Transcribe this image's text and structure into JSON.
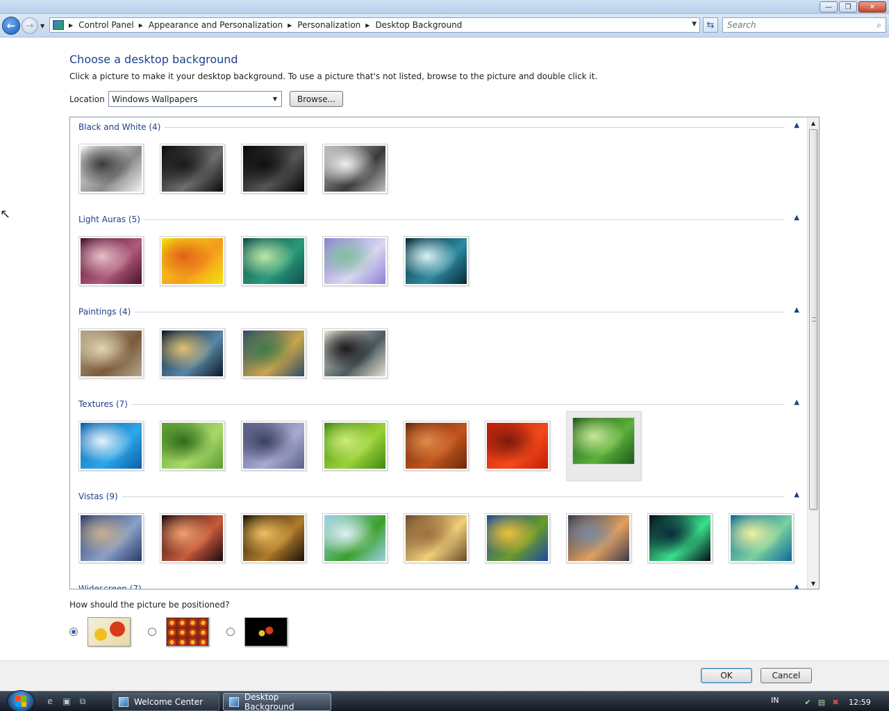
{
  "window": {
    "controls": [
      "minimize",
      "maximize",
      "close"
    ]
  },
  "nav": {
    "breadcrumbs": [
      "Control Panel",
      "Appearance and Personalization",
      "Personalization",
      "Desktop Background"
    ],
    "search_placeholder": "Search"
  },
  "main": {
    "heading": "Choose a desktop background",
    "description": "Click a picture to make it your desktop background. To use a picture that's not listed, browse to the picture and double click it.",
    "location_label": "Location",
    "location_value": "Windows Wallpapers",
    "browse_label": "Browse..."
  },
  "gallery": {
    "groups": [
      {
        "title": "Black and White (4)",
        "thumbs": [
          {
            "name": "bw-1",
            "colors": [
              "#f2f2f2",
              "#8a8a8a",
              "#3b3b3b"
            ]
          },
          {
            "name": "bw-2",
            "colors": [
              "#0a0a0a",
              "#6e6e6e",
              "#1a1a1a"
            ]
          },
          {
            "name": "bw-3",
            "colors": [
              "#050505",
              "#565656",
              "#101010"
            ]
          },
          {
            "name": "bw-4",
            "colors": [
              "#bfbfbf",
              "#3a3a3a",
              "#efefef"
            ]
          }
        ]
      },
      {
        "title": "Light Auras (5)",
        "thumbs": [
          {
            "name": "aura-1",
            "colors": [
              "#4d1130",
              "#b05a7a",
              "#e7c0c8"
            ]
          },
          {
            "name": "aura-2",
            "colors": [
              "#f1e20f",
              "#f59a1d",
              "#e35f1a"
            ]
          },
          {
            "name": "aura-3",
            "colors": [
              "#0c4f4e",
              "#2a9a7a",
              "#bfe7a6"
            ]
          },
          {
            "name": "aura-4",
            "colors": [
              "#8c7fd6",
              "#d9d7f0",
              "#7fbf9f"
            ]
          },
          {
            "name": "aura-5",
            "colors": [
              "#062a35",
              "#2d8aa0",
              "#d9f2f5"
            ]
          }
        ]
      },
      {
        "title": "Paintings (4)",
        "thumbs": [
          {
            "name": "painting-1",
            "colors": [
              "#b3a68b",
              "#7a5a3a",
              "#e2d5b1"
            ]
          },
          {
            "name": "painting-2",
            "colors": [
              "#0b1a28",
              "#5a86a6",
              "#e0c070"
            ]
          },
          {
            "name": "painting-3",
            "colors": [
              "#2e4a6b",
              "#c9a64a",
              "#3f7a4a"
            ]
          },
          {
            "name": "painting-4",
            "colors": [
              "#e8e0d0",
              "#4a5a60",
              "#1a1a1a"
            ]
          }
        ]
      },
      {
        "title": "Textures (7)",
        "thumbs": [
          {
            "name": "texture-1",
            "colors": [
              "#0a5ea8",
              "#2fa6e8",
              "#e7f2fb"
            ]
          },
          {
            "name": "texture-2",
            "colors": [
              "#5a9b2f",
              "#a8d96a",
              "#2f6a1a"
            ]
          },
          {
            "name": "texture-3",
            "colors": [
              "#5a5f8a",
              "#a7aad0",
              "#3b3f60"
            ]
          },
          {
            "name": "texture-4",
            "colors": [
              "#3f8a10",
              "#9bd23a",
              "#cdeb7a"
            ]
          },
          {
            "name": "texture-5",
            "colors": [
              "#6a2a0a",
              "#c2541e",
              "#e28a4a"
            ]
          },
          {
            "name": "texture-6",
            "colors": [
              "#c21e0a",
              "#f24a1a",
              "#7a1a0a"
            ]
          },
          {
            "name": "texture-7",
            "colors": [
              "#1f5a1a",
              "#5ab03a",
              "#c8e89a"
            ],
            "selected": true
          }
        ]
      },
      {
        "title": "Vistas (9)",
        "thumbs": [
          {
            "name": "vista-1",
            "colors": [
              "#2a3a6a",
              "#8aa0c8",
              "#c8b090"
            ]
          },
          {
            "name": "vista-2",
            "colors": [
              "#1a0a10",
              "#c85a3a",
              "#f0a070"
            ]
          },
          {
            "name": "vista-3",
            "colors": [
              "#1a1208",
              "#b07a2a",
              "#f0c060"
            ]
          },
          {
            "name": "vista-4",
            "colors": [
              "#9ad0e8",
              "#3aa02a",
              "#e0f0f8"
            ]
          },
          {
            "name": "vista-5",
            "colors": [
              "#6a4a2a",
              "#f0d07a",
              "#a07040"
            ]
          },
          {
            "name": "vista-6",
            "colors": [
              "#1a4aa0",
              "#6a9a2a",
              "#f0c03a"
            ]
          },
          {
            "name": "vista-7",
            "colors": [
              "#3a3a4a",
              "#e0a060",
              "#7a8aa0"
            ]
          },
          {
            "name": "vista-8",
            "colors": [
              "#030a1a",
              "#3ae08a",
              "#0a2a3a"
            ]
          },
          {
            "name": "vista-9",
            "colors": [
              "#0a6a9a",
              "#7ad0a0",
              "#f0f0a0"
            ]
          }
        ]
      },
      {
        "title": "Widescreen (7)",
        "thumbs": []
      }
    ]
  },
  "position": {
    "question": "How should the picture be positioned?",
    "options": [
      {
        "name": "fit-to-screen",
        "selected": true
      },
      {
        "name": "tile",
        "selected": false
      },
      {
        "name": "center",
        "selected": false
      }
    ]
  },
  "buttons": {
    "ok": "OK",
    "cancel": "Cancel"
  },
  "taskbar": {
    "windows": [
      "Welcome Center",
      "Desktop Background"
    ],
    "language": "IN",
    "clock": "12:59"
  }
}
